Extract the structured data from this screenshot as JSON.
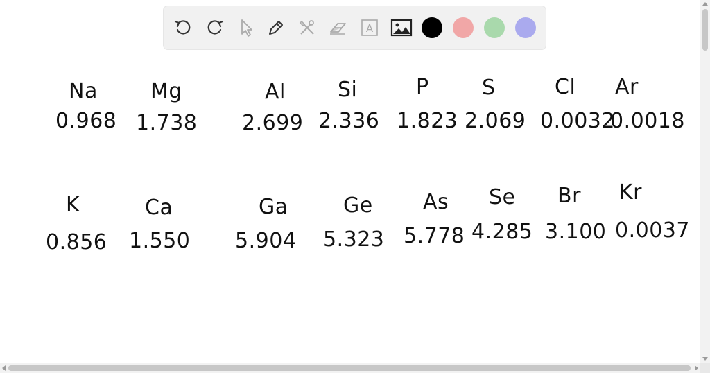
{
  "toolbar": {
    "tools": [
      "undo-icon",
      "redo-icon",
      "pointer-icon",
      "pen-icon",
      "tools-icon",
      "eraser-icon",
      "text-icon",
      "image-icon"
    ],
    "text_tool_label": "A",
    "colors": [
      "#000000",
      "#f1a7a7",
      "#a9d9ac",
      "#aaaaee"
    ]
  },
  "row1": [
    {
      "symbol": "Na",
      "value": "0.968"
    },
    {
      "symbol": "Mg",
      "value": "1.738"
    },
    {
      "symbol": "Al",
      "value": "2.699"
    },
    {
      "symbol": "Si",
      "value": "2.336"
    },
    {
      "symbol": "P",
      "value": "1.823"
    },
    {
      "symbol": "S",
      "value": "2.069"
    },
    {
      "symbol": "Cl",
      "value": "0.0032"
    },
    {
      "symbol": "Ar",
      "value": "0.0018"
    }
  ],
  "row2": [
    {
      "symbol": "K",
      "value": "0.856"
    },
    {
      "symbol": "Ca",
      "value": "1.550"
    },
    {
      "symbol": "Ga",
      "value": "5.904"
    },
    {
      "symbol": "Ge",
      "value": "5.323"
    },
    {
      "symbol": "As",
      "value": "5.778"
    },
    {
      "symbol": "Se",
      "value": "4.285"
    },
    {
      "symbol": "Br",
      "value": "3.100"
    },
    {
      "symbol": "Kr",
      "value": "0.0037"
    }
  ]
}
